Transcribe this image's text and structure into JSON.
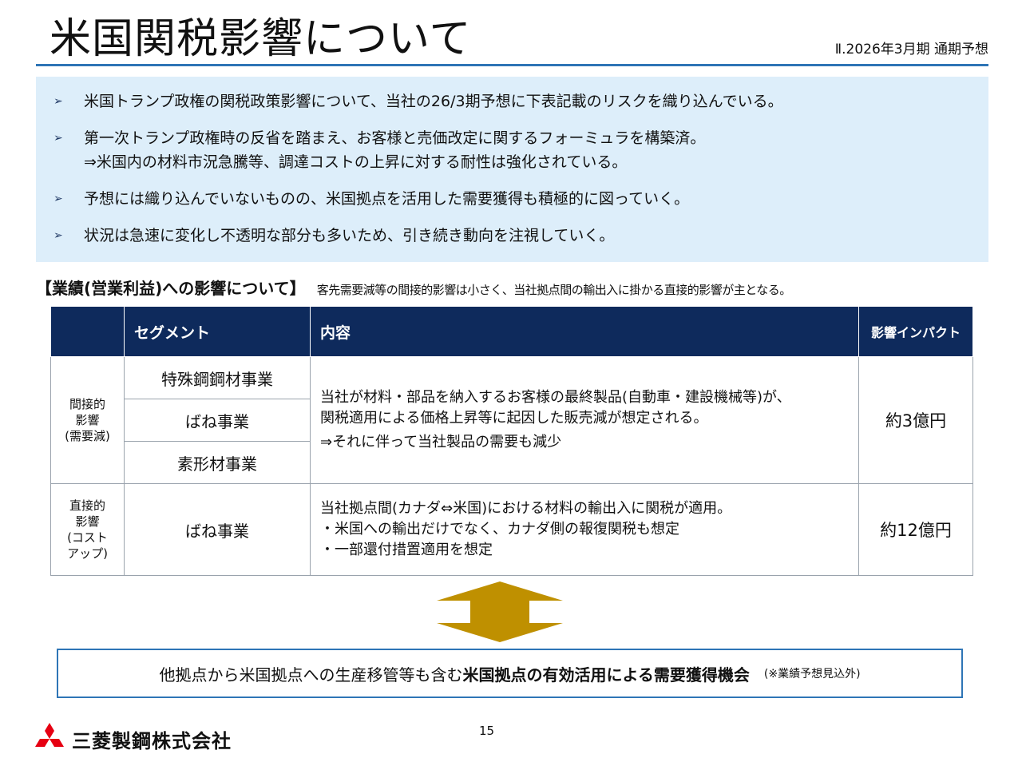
{
  "header": {
    "title": "米国関税影響について",
    "subtitle": "Ⅱ.2026年3月期 通期予想"
  },
  "bullets": [
    "米国トランプ政権の関税政策影響について、当社の26/3期予想に下表記載のリスクを織り込んでいる。",
    "第一次トランプ政権時の反省を踏まえ、お客様と売価改定に関するフォーミュラを構築済。",
    "⇒米国内の材料市況急騰等、調達コストの上昇に対する耐性は強化されている。",
    "予想には織り込んでいないものの、米国拠点を活用した需要獲得も積極的に図っていく。",
    "状況は急速に変化し不透明な部分も多いため、引き続き動向を注視していく。"
  ],
  "bullet_mark": "➢",
  "section": {
    "heading": "【業績(営業利益)への影響について】",
    "note": "客先需要減等の間接的影響は小さく、当社拠点間の輸出入に掛かる直接的影響が主となる。"
  },
  "table": {
    "headers": [
      "",
      "セグメント",
      "内容",
      "影響インパクト"
    ],
    "indirect": {
      "category": [
        "間接的",
        "影響",
        "(需要減)"
      ],
      "segments": [
        "特殊鋼鋼材事業",
        "ばね事業",
        "素形材事業"
      ],
      "content": [
        "当社が材料・部品を納入するお客様の最終製品(自動車・建設機械等)が、",
        "関税適用による価格上昇等に起因した販売減が想定される。",
        "⇒それに伴って当社製品の需要も減少"
      ],
      "impact": "約3億円"
    },
    "direct": {
      "category": [
        "直接的",
        "影響",
        "(コスト",
        "アップ)"
      ],
      "segment": "ばね事業",
      "content": [
        "当社拠点間(カナダ⇔米国)における材料の輸出入に関税が適用。",
        "・米国への輸出だけでなく、カナダ側の報復関税も想定",
        "・一部還付措置適用を想定"
      ],
      "impact": "約12億円"
    }
  },
  "bottom": {
    "text_normal": "他拠点から米国拠点への生産移管等も含む",
    "text_bold": "米国拠点の有効活用による需要獲得機会",
    "text_note": "(※業績予想見込外)"
  },
  "footer": {
    "page": "15",
    "company": "三菱製鋼株式会社"
  },
  "colors": {
    "accent_blue": "#2e75b6",
    "header_navy": "#0e2a5c",
    "bullet_bg": "#ddeefa",
    "arrow_gold": "#bf9000",
    "logo_red": "#e60012"
  }
}
